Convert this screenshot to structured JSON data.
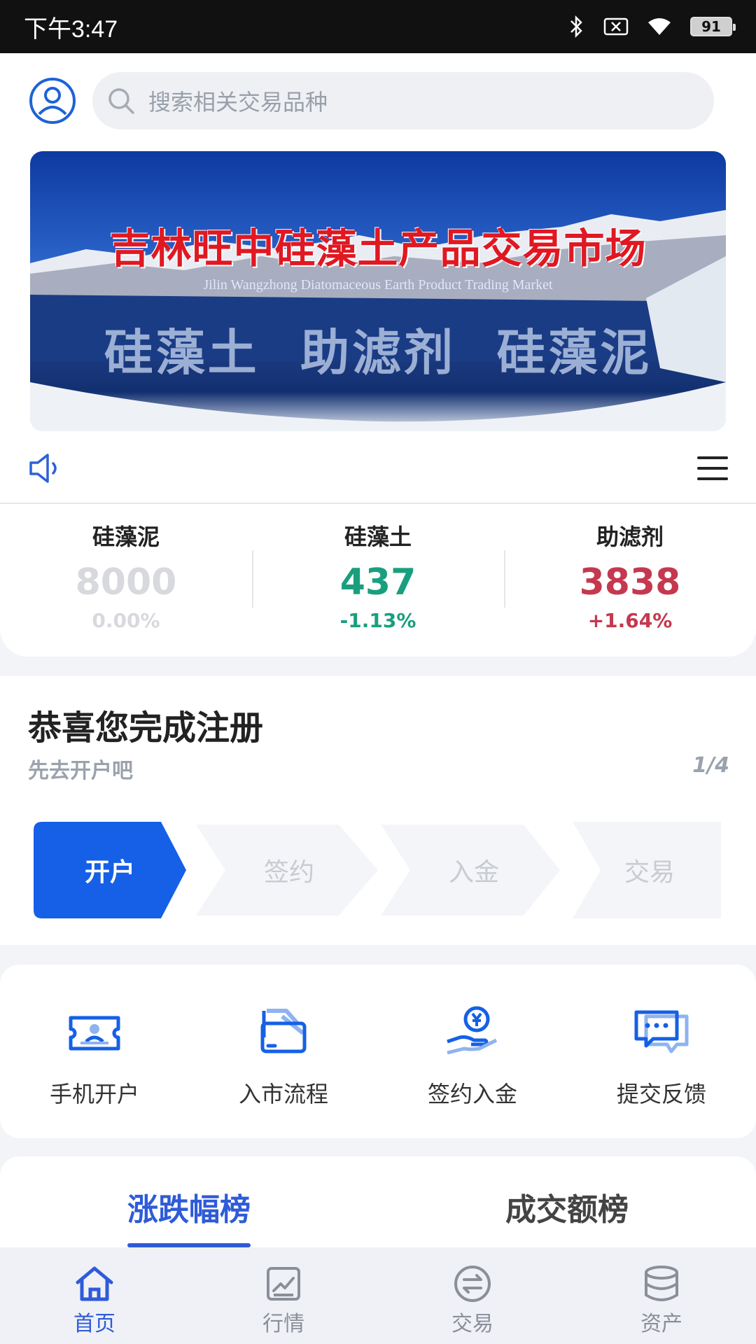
{
  "status_bar": {
    "time": "下午3:47",
    "battery": "91"
  },
  "search": {
    "placeholder": "搜索相关交易品种"
  },
  "banner": {
    "title": "吉林旺中硅藻土产品交易市场",
    "subtitle": "Jilin Wangzhong Diatomaceous Earth Product Trading Market",
    "words": "硅藻土 助滤剂 硅藻泥"
  },
  "ticker": [
    {
      "name": "硅藻泥",
      "price": "8000",
      "change": "0.00%",
      "color": "#d8d9de"
    },
    {
      "name": "硅藻土",
      "price": "437",
      "change": "-1.13%",
      "color": "#1a9f7e"
    },
    {
      "name": "助滤剂",
      "price": "3838",
      "change": "+1.64%",
      "color": "#c5384f"
    }
  ],
  "registration": {
    "title": "恭喜您完成注册",
    "subtitle": "先去开户吧",
    "page": "1/4",
    "steps": [
      "开户",
      "签约",
      "入金",
      "交易"
    ]
  },
  "quick_actions": [
    {
      "label": "手机开户",
      "icon": "id-card-icon"
    },
    {
      "label": "入市流程",
      "icon": "flow-cards-icon"
    },
    {
      "label": "签约入金",
      "icon": "yen-hand-icon"
    },
    {
      "label": "提交反馈",
      "icon": "chat-bubbles-icon"
    }
  ],
  "rank_tabs": [
    "涨跌幅榜",
    "成交额榜"
  ],
  "tabbar": [
    {
      "label": "首页",
      "icon": "home-icon"
    },
    {
      "label": "行情",
      "icon": "chart-icon"
    },
    {
      "label": "交易",
      "icon": "exchange-icon"
    },
    {
      "label": "资产",
      "icon": "database-icon"
    }
  ],
  "colors": {
    "accent": "#1560e6",
    "step_inactive_bg": "#f4f5f8",
    "step_inactive_text": "#c8cbd2",
    "tab_active": "#2f5bd8",
    "tab_inactive": "#8a8f99"
  }
}
